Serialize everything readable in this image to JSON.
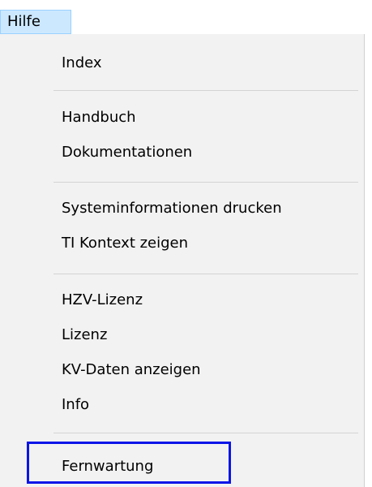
{
  "menubar": {
    "hilfe_label": "Hilfe"
  },
  "menu": {
    "items": [
      {
        "label": "Index"
      },
      {
        "label": "Handbuch"
      },
      {
        "label": "Dokumentationen"
      },
      {
        "label": "Systeminformationen drucken"
      },
      {
        "label": "TI Kontext zeigen"
      },
      {
        "label": "HZV-Lizenz"
      },
      {
        "label": "Lizenz"
      },
      {
        "label": "KV-Daten anzeigen"
      },
      {
        "label": "Info"
      },
      {
        "label": "Fernwartung"
      }
    ]
  },
  "colors": {
    "menubar_highlight": "#cce8ff",
    "menu_background": "#f2f2f2",
    "annotation_box": "#0a14e8"
  }
}
